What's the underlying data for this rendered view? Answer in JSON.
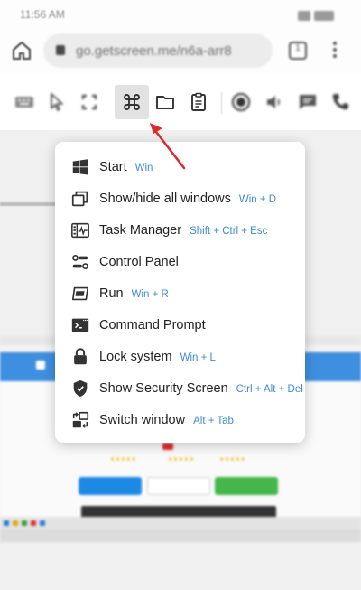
{
  "statusbar": {
    "time": "11:56 AM"
  },
  "browser": {
    "url": "go.getscreen.me/n6a-arr8",
    "tab_count": "1"
  },
  "toolbar": {
    "items": [
      "keyboard-icon",
      "pointer-icon",
      "fullscreen-icon",
      "command-icon",
      "folder-icon",
      "clipboard-icon",
      "record-icon",
      "speaker-icon",
      "chat-icon",
      "phone-icon"
    ],
    "active": "command-icon"
  },
  "menu": {
    "items": [
      {
        "label": "Start",
        "shortcut": "Win",
        "icon": "windows-logo-icon"
      },
      {
        "label": "Show/hide all windows",
        "shortcut": "Win + D",
        "icon": "windows-stack-icon"
      },
      {
        "label": "Task Manager",
        "shortcut": "Shift + Ctrl + Esc",
        "icon": "task-manager-icon"
      },
      {
        "label": "Control Panel",
        "shortcut": "",
        "icon": "toggles-icon"
      },
      {
        "label": "Run",
        "shortcut": "Win + R",
        "icon": "run-icon"
      },
      {
        "label": "Command Prompt",
        "shortcut": "",
        "icon": "terminal-icon"
      },
      {
        "label": "Lock system",
        "shortcut": "Win + L",
        "icon": "lock-icon"
      },
      {
        "label": "Show Security Screen",
        "shortcut": "Ctrl + Alt + Del",
        "icon": "shield-icon"
      },
      {
        "label": "Switch window",
        "shortcut": "Alt + Tab",
        "icon": "switch-window-icon"
      }
    ]
  },
  "colors": {
    "shortcut": "#3d8bd6",
    "arrow": "#e02a2a",
    "remote_banner": "#3e8fe0"
  }
}
